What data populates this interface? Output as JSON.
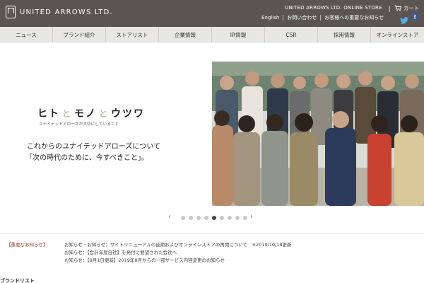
{
  "header": {
    "logo_text": "UNITED ARROWS LTD.",
    "store_link": "UNITED ARROWS LTD. ONLINE STORE",
    "cart_label": "カート",
    "sub_links": [
      "English",
      "お問い合わせ",
      "お客様への重要なお知らせ"
    ],
    "social_icons": [
      "twitter-icon",
      "facebook-icon"
    ]
  },
  "nav": {
    "items": [
      "ニュース",
      "ブランド紹介",
      "ストアリスト",
      "企業情報",
      "IR情報",
      "CSR",
      "採用情報",
      "オンラインストア"
    ]
  },
  "hero": {
    "title_parts": [
      "ヒト",
      "と",
      "モノ",
      "と",
      "ウツワ"
    ],
    "tagline": "ユナイテッドアローズが大切にしていること",
    "copy_line1": "これからのユナイテッドアローズについて",
    "copy_line2": "「次の時代のために、今すべきこと」。"
  },
  "carousel": {
    "prev": "‹",
    "next": "›",
    "dot_count": 9,
    "active_index": 4
  },
  "notices": {
    "label": "【重要なお知らせ】",
    "items": [
      "お知らせ・お知らせ：サイトリニューアルの延期およびオンラインストアの再開について　※2019/10/18更新",
      "お知らせ：【会計年度自社】を発付に要望された会社へ",
      "お知らせ：【8月1日更新】2019年8月からの一部サービス内容変更のお知らせ"
    ]
  },
  "bottom": {
    "label": "ブランドリスト"
  },
  "colors": {
    "header_bg": "#5a5550",
    "nav_bg": "#e8e7e3",
    "notice_label": "#9a3c2e",
    "accent_to": "#c9bba4"
  }
}
